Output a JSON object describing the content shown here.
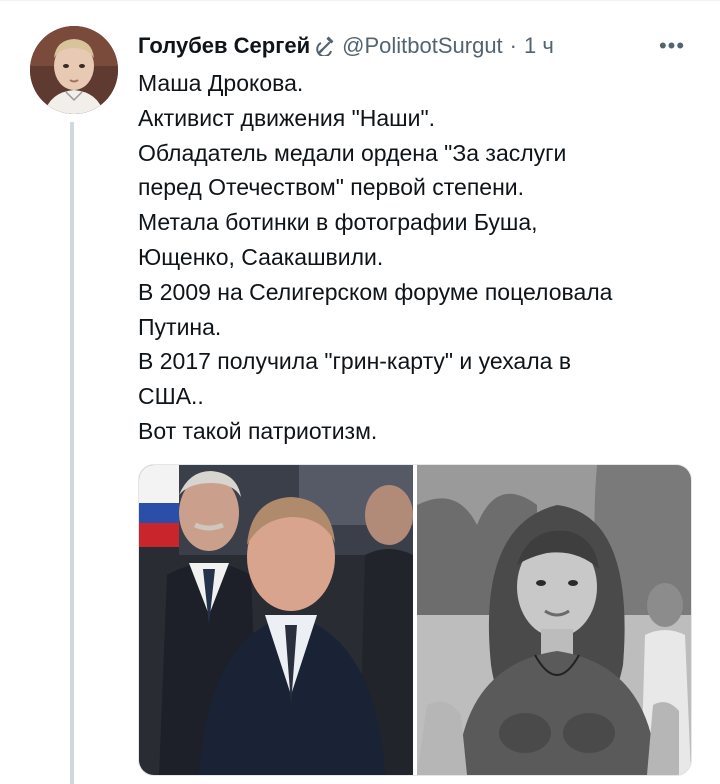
{
  "tweet": {
    "author": {
      "name": "Голубев Сергей",
      "handle": "@PolitbotSurgut",
      "name_emoji": "hammer-sickle-icon"
    },
    "separator": "·",
    "time": "1 ч",
    "more_label": "•••",
    "text_lines": [
      "Маша Дрокова.",
      "Активист движения \"Наши\".",
      "Обладатель медали ордена \"За заслуги",
      "перед Отечеством\" первой степени.",
      "Метала ботинки в фотографии Буша,",
      "Ющенко, Саакашвили.",
      "В 2009 на Селигерском форуме поцеловала",
      "Путина.",
      "В 2017 получила \"грин-карту\" и уехала в",
      "США..",
      "Вот такой патриотизм."
    ],
    "media": [
      {
        "icon": "photo-men-in-suits"
      },
      {
        "icon": "photo-girl-bw"
      }
    ]
  },
  "colors": {
    "text": "#0f1419",
    "secondary": "#536471",
    "thread_line": "#cfd9de"
  }
}
